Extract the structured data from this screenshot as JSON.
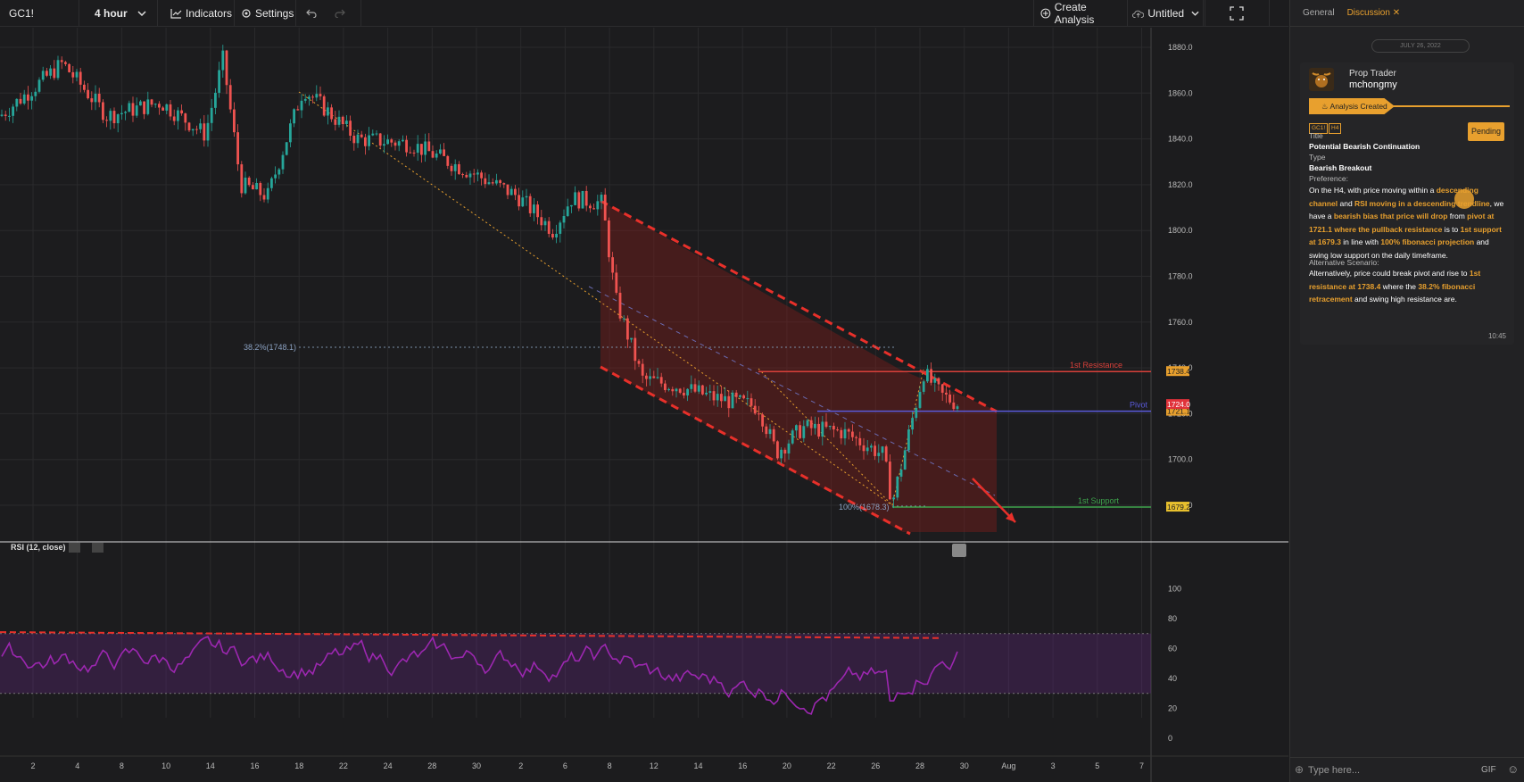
{
  "toolbar": {
    "symbol": "GC1!",
    "interval": "4 hour",
    "indicators_label": "Indicators",
    "settings_label": "Settings",
    "create_analysis_label": "Create Analysis",
    "layout_name": "Untitled"
  },
  "chart": {
    "price_ticks": [
      "1880.0",
      "1860.0",
      "1840.0",
      "1820.0",
      "1800.0",
      "1780.0",
      "1760.0",
      "1740.0",
      "1720.0",
      "1700.0",
      "1680.0"
    ],
    "date_ticks": [
      "2",
      "4",
      "8",
      "10",
      "14",
      "16",
      "18",
      "22",
      "24",
      "28",
      "30",
      "2",
      "6",
      "8",
      "12",
      "14",
      "16",
      "20",
      "22",
      "26",
      "28",
      "30",
      "Aug",
      "3",
      "5",
      "7"
    ],
    "fib_top_label": "38.2%(1748.1)",
    "fib_bottom_label": "100%(1678.3)",
    "lines": [
      {
        "label": "1st Resistance",
        "price_tag": "1738.4",
        "color": "#d9403a"
      },
      {
        "label": "Pivot",
        "price_tag": "1721.1",
        "color": "#5a5adc"
      },
      {
        "label": "1st Support",
        "price_tag": "1679.2",
        "color": "#3fa34d"
      }
    ],
    "current_price_tag": "1724.0",
    "rsi_label": "RSI (12, close)",
    "rsi_ticks": [
      "100",
      "80",
      "60",
      "40",
      "20",
      "0"
    ]
  },
  "colors": {
    "up": "#26a69a",
    "down": "#ef5350",
    "accent": "#e8a02e",
    "rsi": "#9c27b0"
  },
  "panel": {
    "tabs": [
      {
        "label": "General"
      },
      {
        "label": "Discussion"
      }
    ],
    "date_divider": "JULY 26, 2022",
    "user_role": "Prop Trader",
    "user_name": "mchongmy",
    "status_ribbon": "Analysis Created",
    "tags": [
      "GC1!",
      "H4"
    ],
    "status": "Pending",
    "title_label": "Title",
    "title_value": "Potential Bearish Continuation",
    "type_label": "Type",
    "type_value": "Bearish Breakout",
    "preference_label": "Preference:",
    "preference_text": [
      {
        "t": "On the H4, with price moving within a ",
        "h": false
      },
      {
        "t": "descending channel",
        "h": true
      },
      {
        "t": " and ",
        "h": false
      },
      {
        "t": "RSI moving in a descending trendline",
        "h": true
      },
      {
        "t": ", we have a ",
        "h": false
      },
      {
        "t": "bearish bias that price will drop",
        "h": true
      },
      {
        "t": " from ",
        "h": false
      },
      {
        "t": "pivot at 1721.1 where the pullback resistance",
        "h": true
      },
      {
        "t": " is to ",
        "h": false
      },
      {
        "t": "1st support at 1679.3",
        "h": true
      },
      {
        "t": " in line with ",
        "h": false
      },
      {
        "t": "100% fibonacci projection",
        "h": true
      },
      {
        "t": " and swing low support on the daily timeframe.",
        "h": false
      }
    ],
    "alternative_label": "Alternative Scenario:",
    "alternative_text": [
      {
        "t": "Alternatively, price could break pivot and rise to ",
        "h": false
      },
      {
        "t": "1st resistance at 1738.4",
        "h": true
      },
      {
        "t": " where the ",
        "h": false
      },
      {
        "t": "38.2% fibonacci retracement",
        "h": true
      },
      {
        "t": " and swing high resistance are.",
        "h": false
      }
    ],
    "time": "10:45",
    "input_placeholder": "Type here...",
    "gif_label": "GIF"
  }
}
